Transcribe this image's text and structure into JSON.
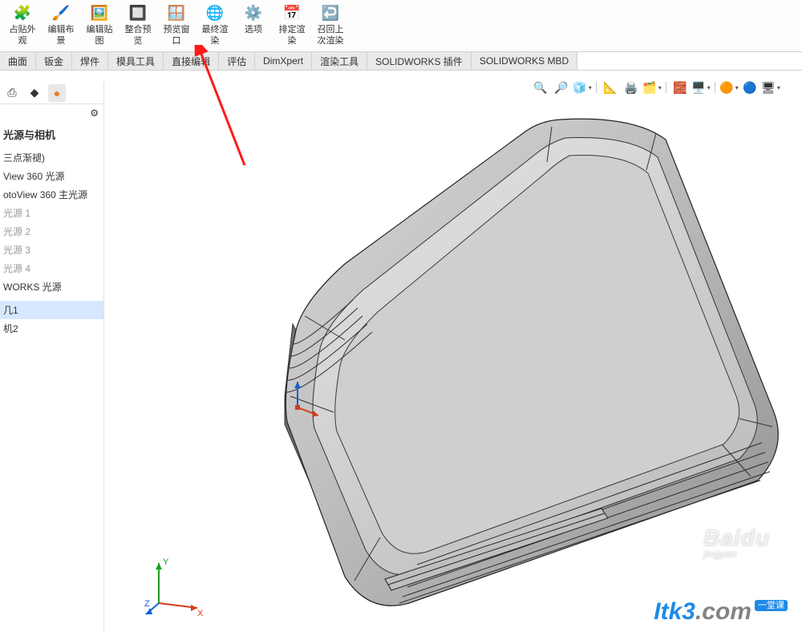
{
  "toolbar": {
    "items": [
      {
        "icon": "🧩",
        "l1": "占贴外",
        "l2": "观"
      },
      {
        "icon": "🖌️",
        "l1": "编辑布",
        "l2": "景"
      },
      {
        "icon": "🖼️",
        "l1": "编辑贴",
        "l2": "图"
      },
      {
        "icon": "🔲",
        "l1": "整合预",
        "l2": "览"
      },
      {
        "icon": "🪟",
        "l1": "预览窗",
        "l2": "口"
      },
      {
        "icon": "🌐",
        "l1": "最终渲",
        "l2": "染"
      },
      {
        "icon": "⚙️",
        "l1": "选项",
        "l2": ""
      },
      {
        "icon": "📅",
        "l1": "排定渲",
        "l2": "染"
      },
      {
        "icon": "↩️",
        "l1": "召回上",
        "l2": "次渲染"
      }
    ]
  },
  "tabs": {
    "items": [
      "曲面",
      "钣金",
      "焊件",
      "模具工具",
      "直接编辑",
      "评估",
      "DimXpert",
      "渲染工具",
      "SOLIDWORKS 插件",
      "SOLIDWORKS MBD"
    ]
  },
  "hud": {
    "icons": [
      "🔍",
      "🔎",
      "🧊",
      "📐",
      "🖨️",
      "🗂️",
      "🧱",
      "🖥️",
      "🟠",
      "🔵",
      "🖥"
    ]
  },
  "panel": {
    "tabs": {
      "t1": "⎙",
      "t2": "◆",
      "t3": "●"
    },
    "gear": "⚙",
    "title": "光源与相机",
    "items": [
      {
        "text": "三点渐褪)",
        "dim": false
      },
      {
        "text": "View 360 光源",
        "dim": false
      },
      {
        "text": "otoView 360 主光源",
        "dim": false
      },
      {
        "text": "光源 1",
        "dim": true
      },
      {
        "text": "光源 2",
        "dim": true
      },
      {
        "text": "光源 3",
        "dim": true
      },
      {
        "text": "光源 4",
        "dim": true
      },
      {
        "text": "WORKS 光源",
        "dim": false
      },
      {
        "text": "",
        "dim": false
      },
      {
        "text": "几1",
        "dim": false,
        "sel": true
      },
      {
        "text": "机2",
        "dim": false
      }
    ]
  },
  "triad": {
    "x": "X",
    "y": "Y",
    "z": "Z"
  },
  "watermark": {
    "baidu": "Baidu",
    "baidu_sub": "jingyan",
    "itk3_a": "Itk3",
    "itk3_b": ".com",
    "itk3_tag": "一堂课"
  }
}
